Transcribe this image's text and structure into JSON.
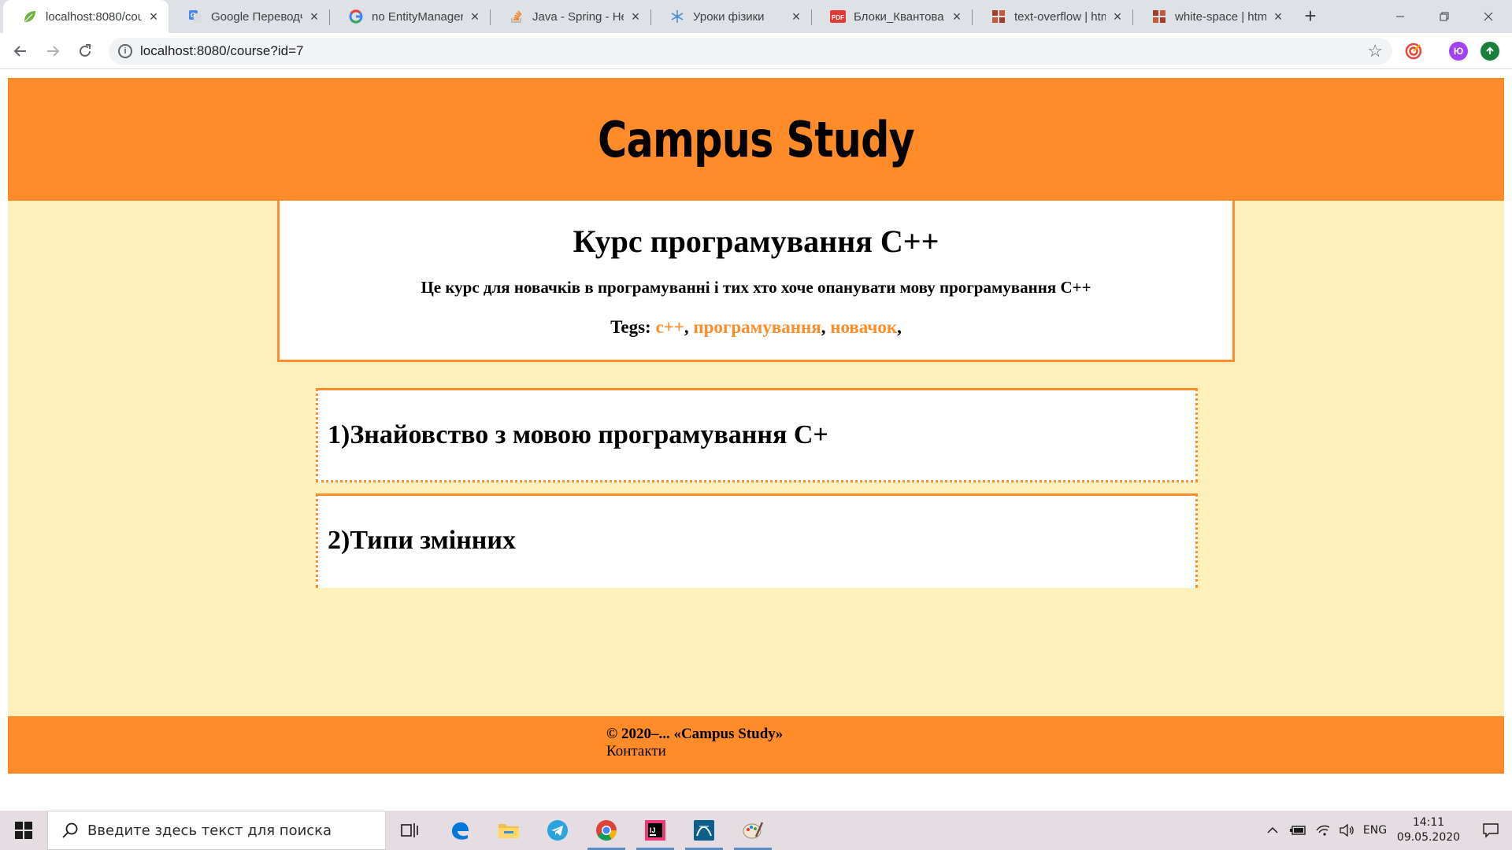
{
  "browser": {
    "tabs": [
      {
        "title": "localhost:8080/cou",
        "icon": "spring-leaf-icon",
        "active": true
      },
      {
        "title": "Google Переводч",
        "icon": "google-translate-icon",
        "active": false
      },
      {
        "title": "no EntityManager",
        "icon": "google-icon",
        "active": false
      },
      {
        "title": "Java - Spring - Her",
        "icon": "stackoverflow-icon",
        "active": false
      },
      {
        "title": "Уроки фізики",
        "icon": "snowflake-icon",
        "active": false
      },
      {
        "title": "Блоки_Квантова т",
        "icon": "pdf-icon",
        "active": false
      },
      {
        "title": "text-overflow | htm",
        "icon": "htmlbook-icon",
        "active": false
      },
      {
        "title": "white-space | html",
        "icon": "htmlbook-icon",
        "active": false
      }
    ],
    "address": "localhost:8080/course?id=7",
    "profile_initial": "Ю"
  },
  "site": {
    "title": "Campus Study",
    "course": {
      "title": "Курс програмування C++",
      "description": "Це курс для новачків в програмуванні і тих хто хоче опанувати мову програмування C++",
      "tags_label": "Tegs:",
      "tags": [
        "c++",
        "програмування",
        "новачок"
      ]
    },
    "lessons": [
      {
        "title": "1)Знайовство з мовою програмування C+"
      },
      {
        "title": "2)Типи змінних"
      }
    ],
    "footer": {
      "copyright": "© 2020–... «Campus Study»",
      "contacts": "Контакти"
    }
  },
  "taskbar": {
    "search_placeholder": "Введите здесь текст для поиска",
    "language": "ENG",
    "time": "14:11",
    "date": "09.05.2020"
  },
  "colors": {
    "accent": "#ff8c28",
    "page_background": "#fdf0bb"
  }
}
